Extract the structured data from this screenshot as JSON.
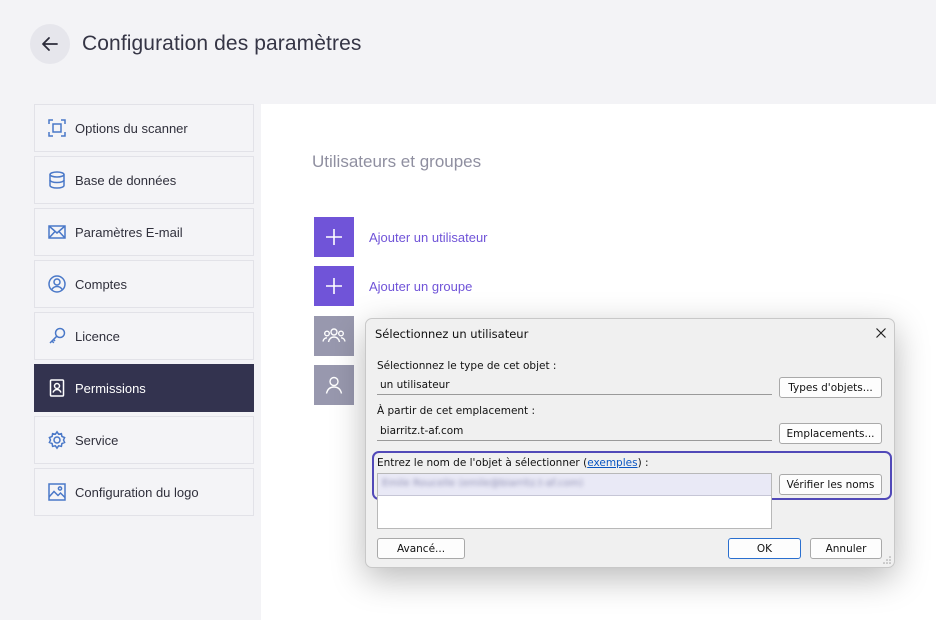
{
  "header": {
    "title": "Configuration des paramètres"
  },
  "sidebar": {
    "items": [
      {
        "label": "Options du scanner",
        "icon": "scanner-frame-icon"
      },
      {
        "label": "Base de données",
        "icon": "database-icon"
      },
      {
        "label": "Paramètres E-mail",
        "icon": "envelope-icon"
      },
      {
        "label": "Comptes",
        "icon": "user-circle-icon"
      },
      {
        "label": "Licence",
        "icon": "key-icon"
      },
      {
        "label": "Permissions",
        "icon": "badge-icon",
        "active": true
      },
      {
        "label": "Service",
        "icon": "gear-icon"
      },
      {
        "label": "Configuration du logo",
        "icon": "image-icon"
      }
    ]
  },
  "main": {
    "section_title": "Utilisateurs et groupes",
    "add_user_label": "Ajouter un utilisateur",
    "add_group_label": "Ajouter un groupe"
  },
  "dialog": {
    "title": "Sélectionnez un utilisateur",
    "type_label": "Sélectionnez le type de cet objet :",
    "type_value": "un utilisateur",
    "types_button": "Types d'objets...",
    "location_label": "À partir de cet emplacement :",
    "location_value": "biarritz.t-af.com",
    "locations_button": "Emplacements...",
    "names_label_prefix": "Entrez le nom de l'objet à sélectionner (",
    "names_label_link": "exemples",
    "names_label_suffix": ") :",
    "names_value": "Emile Roucelle (emile@biarritz.t-af.com)",
    "check_names_button": "Vérifier les noms",
    "advanced_button": "Avancé...",
    "ok_button": "OK",
    "cancel_button": "Annuler"
  },
  "colors": {
    "accent": "#7054d8",
    "sidebar_active": "#33334f",
    "highlight": "#5149b8"
  }
}
